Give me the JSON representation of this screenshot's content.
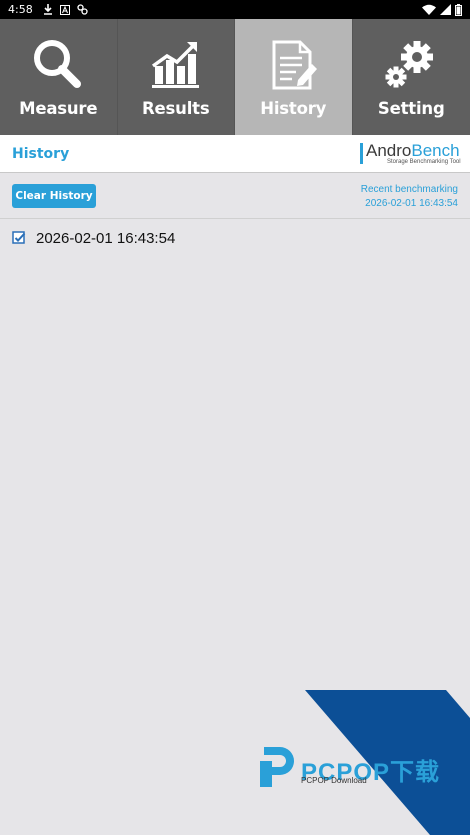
{
  "status_bar": {
    "time": "4:58",
    "left_icons": [
      "download-icon",
      "a-icon",
      "link-icon"
    ],
    "right_icons": [
      "wifi-icon",
      "signal-icon",
      "battery-icon"
    ]
  },
  "tabs": [
    {
      "label": "Measure",
      "icon": "search-icon",
      "active": false
    },
    {
      "label": "Results",
      "icon": "chart-icon",
      "active": false
    },
    {
      "label": "History",
      "icon": "document-icon",
      "active": true
    },
    {
      "label": "Setting",
      "icon": "gear-icon",
      "active": false
    }
  ],
  "header": {
    "title": "History",
    "logo_name_1": "Andro",
    "logo_name_2": "Bench",
    "logo_sub": "Storage Benchmarking Tool"
  },
  "toolbar": {
    "clear_label": "Clear History",
    "recent_label": "Recent benchmarking",
    "recent_date": "2026-02-01 16:43:54"
  },
  "history": {
    "items": [
      "2026-02-01 16:43:54"
    ]
  },
  "watermark": {
    "text": "PCPOP下载",
    "sub": "PCPOP Download"
  },
  "colors": {
    "accent": "#2aa0d8",
    "tab_bg": "#5f5f5f",
    "tab_active_bg": "#b6b6b6",
    "content_bg": "#e6e5e8",
    "watermark_blue": "#0c4f96"
  }
}
